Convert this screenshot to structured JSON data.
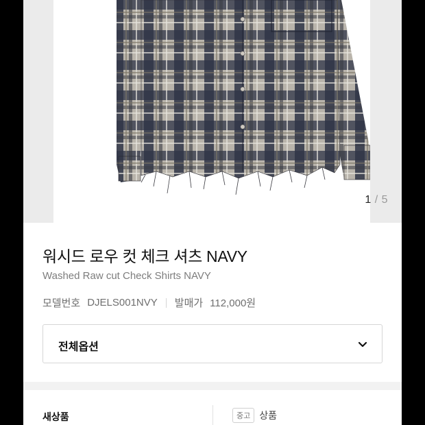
{
  "gallery": {
    "image_alt": "plaid flannel shirt with raw-cut hem",
    "current_index": "1",
    "separator": " / ",
    "total": "5",
    "colors": {
      "plaid_dark": "#2e3447",
      "plaid_light": "#b9b4ab",
      "plaid_mid": "#6f6e72"
    }
  },
  "product": {
    "title_ko": "워시드 로우 컷 체크 셔츠 NAVY",
    "title_en": "Washed Raw cut Check Shirts NAVY",
    "model_label": "모델번호",
    "model_number": "DJELS001NVY",
    "release_label": "발매가",
    "release_price": "112,000원"
  },
  "options": {
    "label": "전체옵션",
    "chevron_icon": "chevron-down-icon"
  },
  "condition": {
    "left_label": "새상품",
    "badge": "중고",
    "right_label": "상품"
  }
}
